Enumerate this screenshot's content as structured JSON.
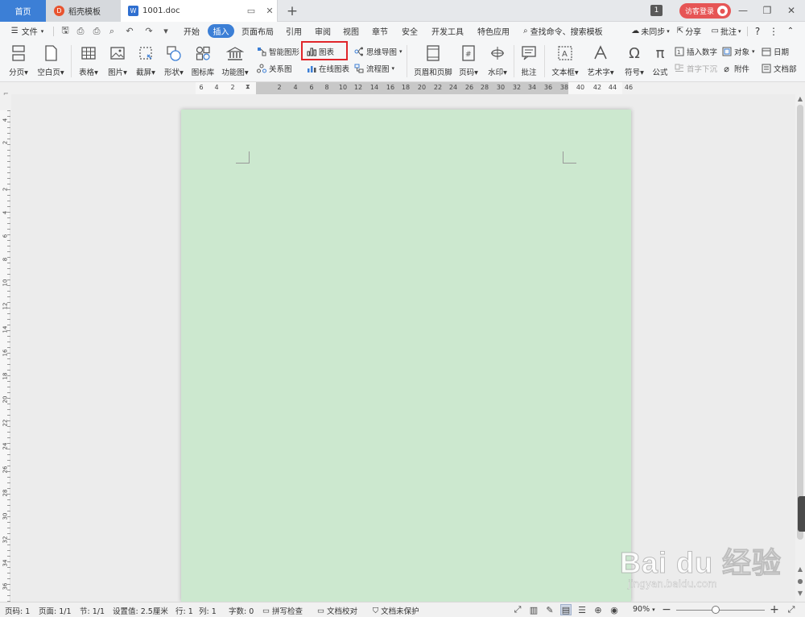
{
  "tabs": {
    "home": "首页",
    "template": "稻壳模板",
    "document": "1001.doc"
  },
  "window": {
    "count_badge": "1",
    "login": "访客登录"
  },
  "menu": {
    "file": "文件",
    "items": [
      "开始",
      "插入",
      "页面布局",
      "引用",
      "审阅",
      "视图",
      "章节",
      "安全",
      "开发工具",
      "特色应用"
    ],
    "active_index": 1,
    "search": "查找命令、搜索模板",
    "sync": "未同步",
    "share": "分享",
    "comment": "批注",
    "help": "?"
  },
  "ribbon": {
    "page_break": "分页",
    "blank_page": "空白页",
    "table": "表格",
    "picture": "图片",
    "screenshot": "截屏",
    "shapes": "形状",
    "icon_library": "图标库",
    "function_chart": "功能图",
    "smart_art": "智能图形",
    "chart": "图表",
    "mind_map": "思维导图",
    "relation_chart": "关系图",
    "online_chart": "在线图表",
    "flowchart": "流程图",
    "header_footer": "页眉和页脚",
    "page_number": "页码",
    "watermark": "水印",
    "comment": "批注",
    "textbox": "文本框",
    "wordart": "艺术字",
    "symbol": "符号",
    "formula": "公式",
    "insert_number": "插入数字",
    "drop_cap": "首字下沉",
    "object": "对象",
    "attachment": "附件",
    "date": "日期",
    "doc_part": "文档部"
  },
  "ruler": {
    "h_labels": [
      "6",
      "4",
      "2",
      "2",
      "4",
      "6",
      "8",
      "10",
      "12",
      "14",
      "16",
      "18",
      "20",
      "22",
      "24",
      "26",
      "28",
      "30",
      "32",
      "34",
      "36",
      "38",
      "40",
      "42",
      "44",
      "46"
    ],
    "v_labels": [
      "4",
      "2",
      "2",
      "4",
      "6",
      "8",
      "10",
      "12",
      "14",
      "16",
      "18",
      "20",
      "22",
      "24",
      "26",
      "28",
      "30",
      "32",
      "34",
      "36"
    ]
  },
  "status": {
    "page_no": "页码: 1",
    "pages": "页面: 1/1",
    "section": "节: 1/1",
    "setting": "设置值: 2.5厘米",
    "row": "行: 1",
    "col": "列: 1",
    "words": "字数: 0",
    "spell_check": "拼写检查",
    "doc_proof": "文档校对",
    "doc_protect": "文档未保护",
    "zoom": "90%"
  },
  "watermark": {
    "main": "Bai du 经验",
    "sub": "jingyan.baidu.com"
  },
  "colors": {
    "accent": "#3c7fd6",
    "page_background": "#cce8cf",
    "highlight_box": "#e0262b",
    "login_button": "#e65555"
  }
}
